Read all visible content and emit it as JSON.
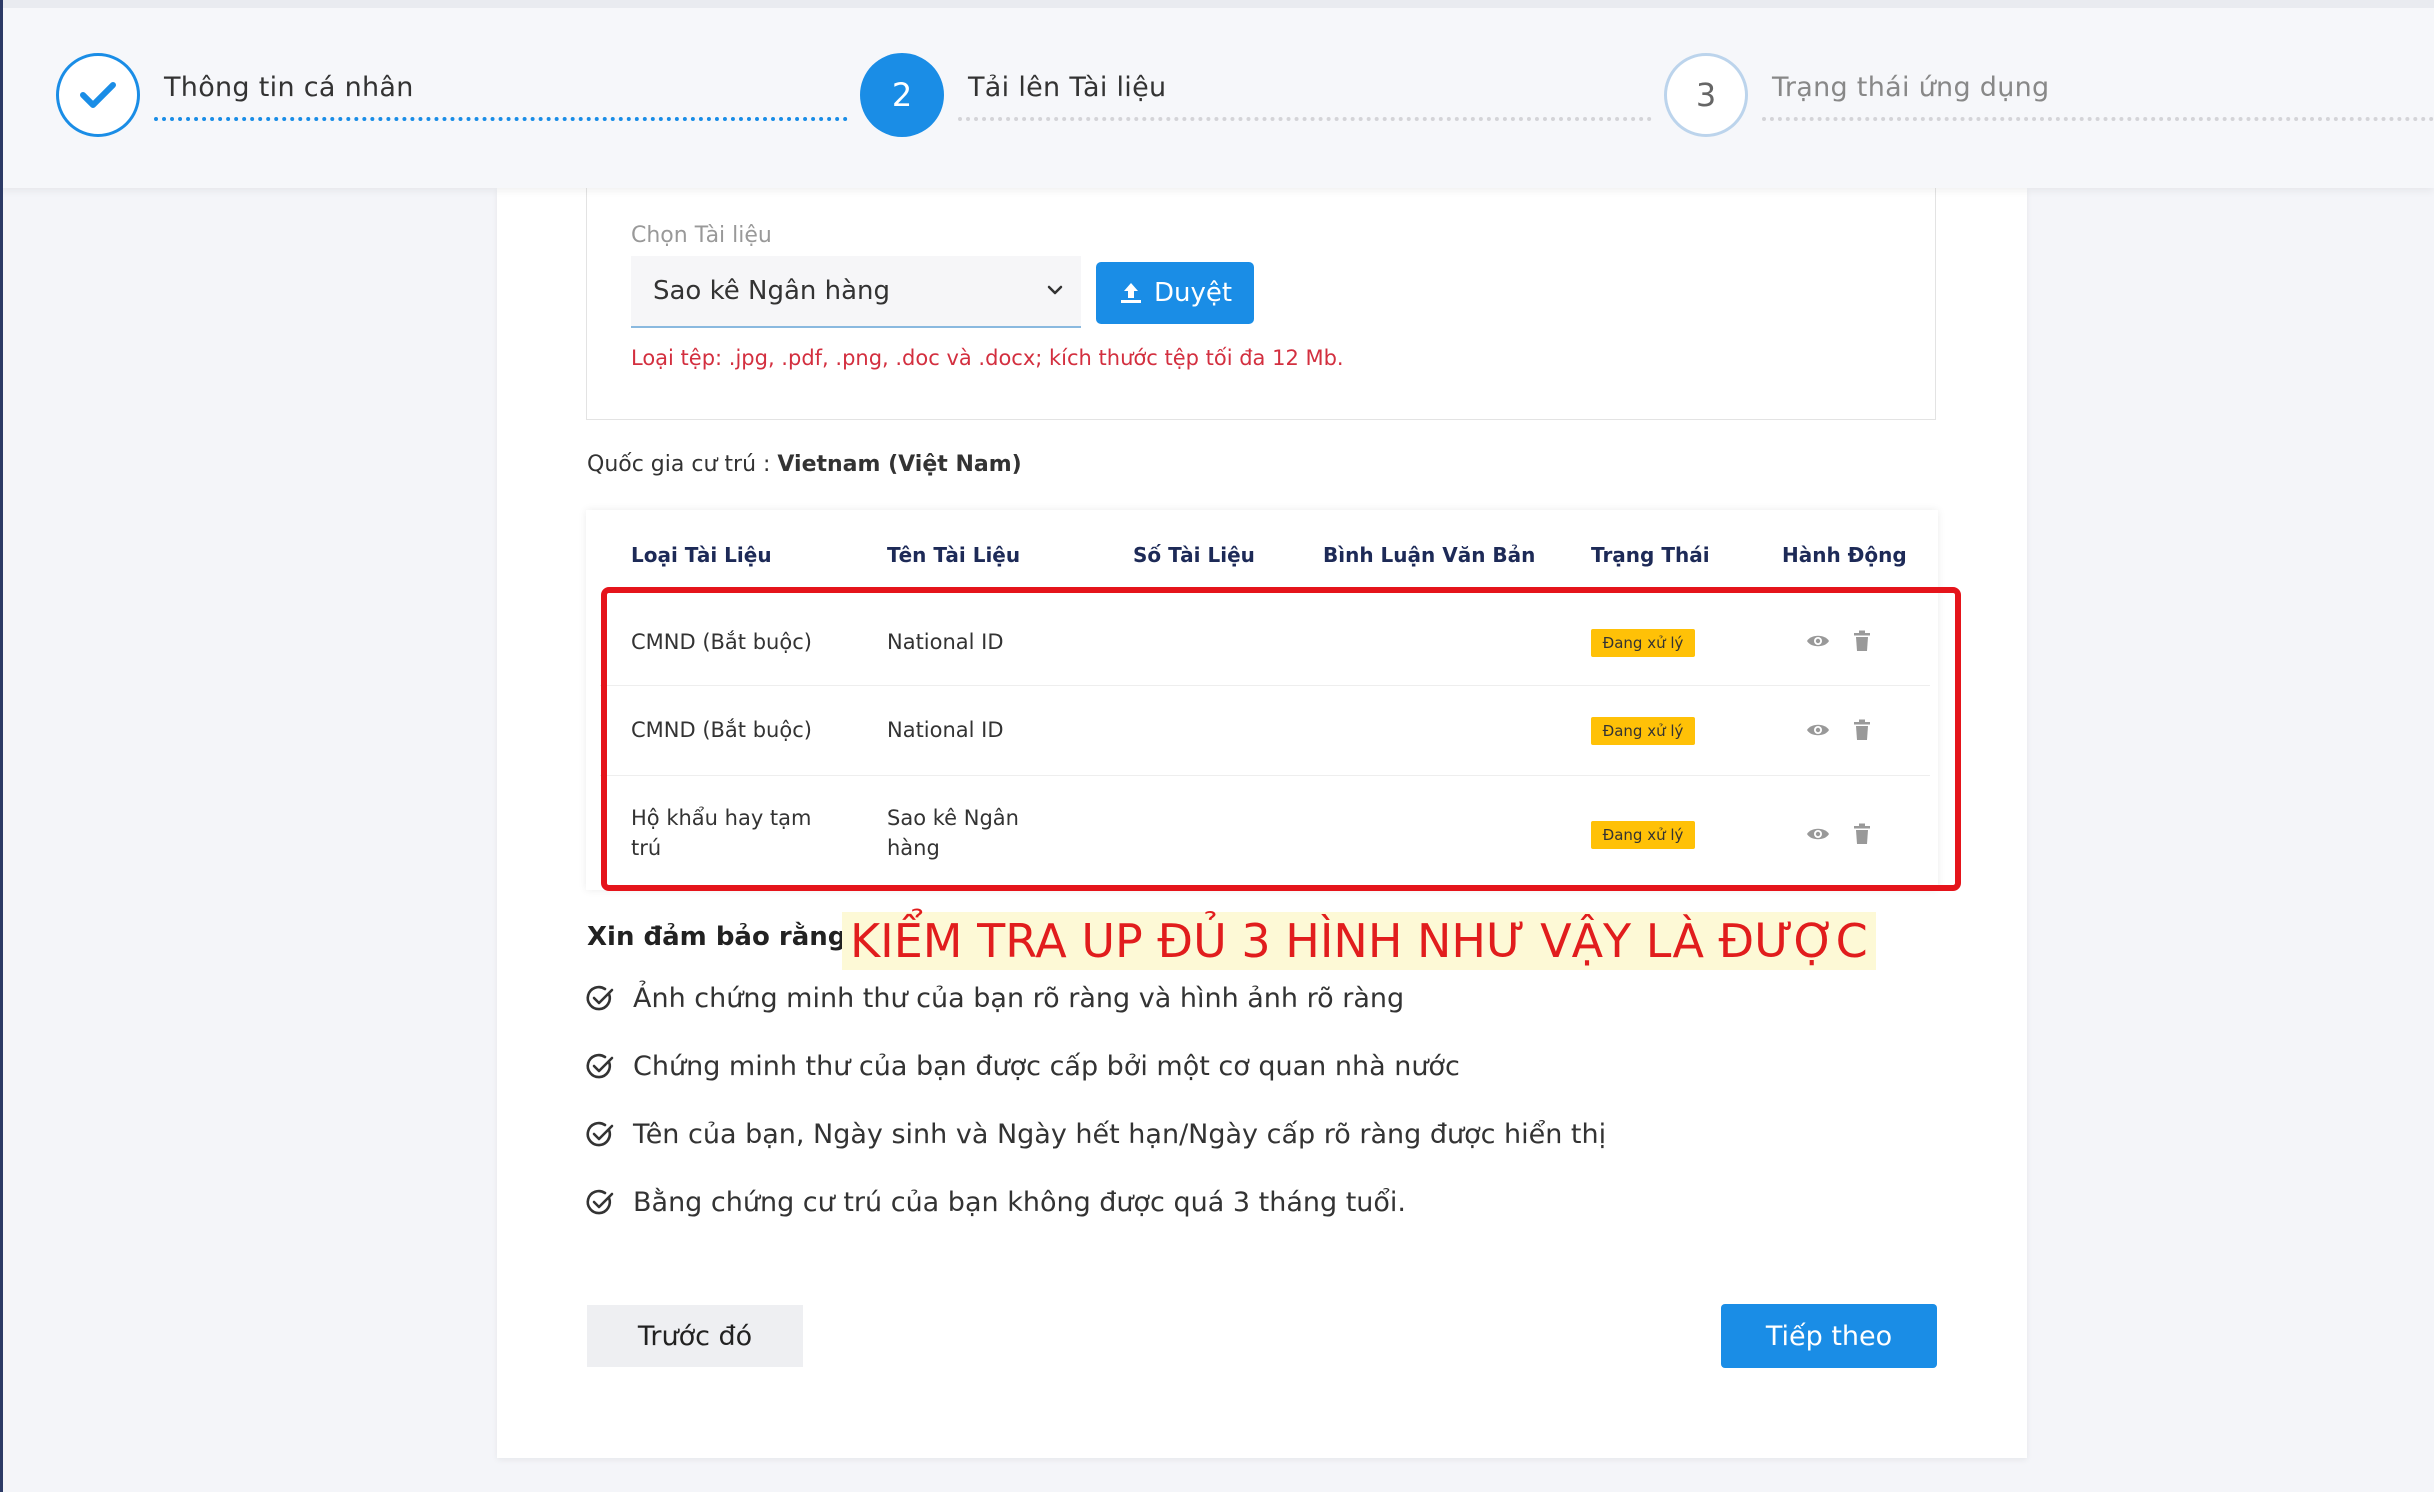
{
  "stepper": {
    "steps": [
      {
        "number": "",
        "label": "Thông tin cá nhân",
        "state": "done"
      },
      {
        "number": "2",
        "label": "Tải lên Tài liệu",
        "state": "active"
      },
      {
        "number": "3",
        "label": "Trạng thái ứng dụng",
        "state": "pending"
      }
    ]
  },
  "upload": {
    "choose_label": "Chọn Tài liệu",
    "selected_document": "Sao kê Ngân hàng",
    "browse_label": "Duyệt",
    "file_hint": "Loại tệp: .jpg, .pdf, .png, .doc và .docx; kích thước tệp tối đa 12 Mb."
  },
  "country": {
    "label": "Quốc gia cư trú : ",
    "value": "Vietnam (Việt Nam)"
  },
  "table": {
    "headers": [
      "Loại Tài Liệu",
      "Tên Tài Liệu",
      "Số Tài Liệu",
      "Bình Luận Văn Bản",
      "Trạng Thái",
      "Hành Động"
    ],
    "rows": [
      {
        "type": "CMND (Bắt buộc)",
        "name": "National ID",
        "number": "",
        "comment": "",
        "status": "Đang xử lý"
      },
      {
        "type": "CMND (Bắt buộc)",
        "name": "National ID",
        "number": "",
        "comment": "",
        "status": "Đang xử lý"
      },
      {
        "type": "Hộ khẩu hay tạm trú",
        "name": "Sao kê Ngân hàng",
        "number": "",
        "comment": "",
        "status": "Đang xử lý"
      }
    ]
  },
  "requirements": {
    "title": "Xin đảm bảo rằng :",
    "items": [
      "Ảnh chứng minh thư của bạn rõ ràng và hình ảnh rõ ràng",
      "Chứng minh thư của bạn được cấp bởi một cơ quan nhà nước",
      "Tên của bạn, Ngày sinh và Ngày hết hạn/Ngày cấp rõ ràng được hiển thị",
      "Bằng chứng cư trú của bạn không được quá 3 tháng tuổi."
    ]
  },
  "annotation": {
    "text": "KIỂM TRA UP ĐỦ 3  HÌNH NHƯ VẬY LÀ ĐƯỢC",
    "color": "#e11d1d"
  },
  "buttons": {
    "prev": "Trước đó",
    "next": "Tiếp theo"
  },
  "colors": {
    "primary": "#1a8de6",
    "status_badge": "#ffc107",
    "error": "#d32f3f",
    "highlight_box": "#e5141b"
  }
}
